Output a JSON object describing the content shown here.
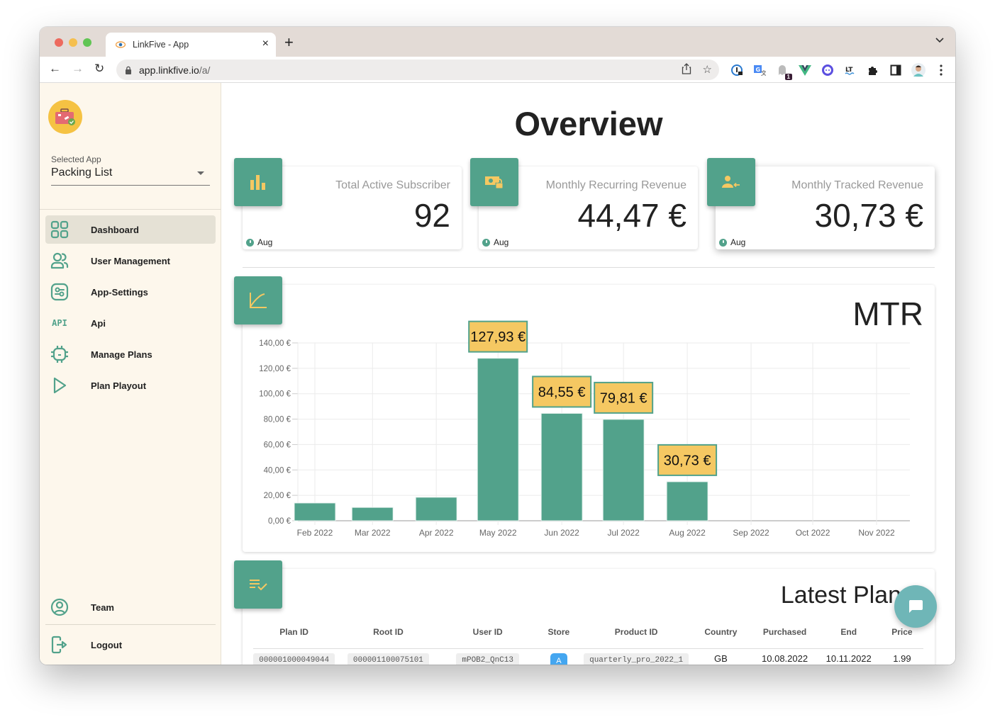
{
  "browser": {
    "tab_title": "LinkFive - App",
    "tab_close": "×",
    "new_tab": "+",
    "url_host": "app.linkfive.io",
    "url_path": "/a/",
    "extension_badge": "1"
  },
  "sidebar": {
    "selected_app_label": "Selected App",
    "selected_app_value": "Packing List",
    "items": [
      {
        "label": "Dashboard",
        "icon": "dashboard-grid-icon",
        "active": true
      },
      {
        "label": "User Management",
        "icon": "users-icon",
        "active": false
      },
      {
        "label": "App-Settings",
        "icon": "settings-sliders-icon",
        "active": false
      },
      {
        "label": "Api",
        "icon": "api-icon",
        "icon_text": "API",
        "active": false
      },
      {
        "label": "Manage Plans",
        "icon": "chip-icon",
        "active": false
      },
      {
        "label": "Plan Playout",
        "icon": "play-icon",
        "active": false
      }
    ],
    "bottom_items": [
      {
        "label": "Team",
        "icon": "account-circle-icon"
      },
      {
        "label": "Logout",
        "icon": "logout-icon"
      }
    ]
  },
  "main": {
    "title": "Overview",
    "stats": [
      {
        "label": "Total Active Subscriber",
        "value": "92",
        "period": "Aug",
        "icon": "bar-chart-icon"
      },
      {
        "label": "Monthly Recurring Revenue",
        "value": "44,47 €",
        "period": "Aug",
        "icon": "money-lock-icon"
      },
      {
        "label": "Monthly Tracked Revenue",
        "value": "30,73 €",
        "period": "Aug",
        "icon": "person-arrow-icon"
      }
    ],
    "table": {
      "title": "Latest Plans",
      "columns": [
        "Plan ID",
        "Root ID",
        "User ID",
        "Store",
        "Product ID",
        "Country",
        "Purchased",
        "End",
        "Price"
      ],
      "rows": [
        {
          "plan_id": "000001000049044",
          "root_id": "000001100075101",
          "user_id": "mPOB2_QnC13",
          "store": "apple-store",
          "product_id": "quarterly_pro_2022_1",
          "country": "GB",
          "purchased": "10.08.2022",
          "end": "10.11.2022",
          "price": "1.99"
        }
      ]
    }
  },
  "colors": {
    "accent": "#52a28b",
    "highlight": "#f5c862",
    "sidebar_bg": "#fdf7ec",
    "chat_fab": "#6fb6b7"
  },
  "chart_data": {
    "type": "bar",
    "title": "MTR",
    "xlabel": "",
    "ylabel": "",
    "categories": [
      "Feb 2022",
      "Mar 2022",
      "Apr 2022",
      "May 2022",
      "Jun 2022",
      "Jul 2022",
      "Aug 2022",
      "Sep 2022",
      "Oct 2022",
      "Nov 2022"
    ],
    "values": [
      14.0,
      10.5,
      18.5,
      127.93,
      84.55,
      79.81,
      30.73,
      null,
      null,
      null
    ],
    "data_labels": [
      null,
      null,
      null,
      "127,93 €",
      "84,55 €",
      "79,81 €",
      "30,73 €",
      null,
      null,
      null
    ],
    "yticks": [
      "0,00 €",
      "20,00 €",
      "40,00 €",
      "60,00 €",
      "80,00 €",
      "100,00 €",
      "120,00 €",
      "140,00 €"
    ],
    "ylim": [
      0,
      140
    ],
    "grid": true,
    "legend": "none"
  }
}
